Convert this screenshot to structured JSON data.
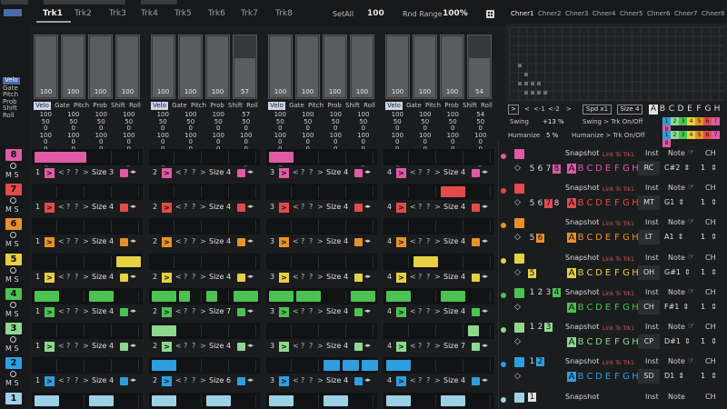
{
  "header": {
    "tabs": [
      "Trk1",
      "Trk2",
      "Trk3",
      "Trk4",
      "Trk5",
      "Trk6",
      "Trk7",
      "Trk8"
    ],
    "active_tab": "Trk1",
    "setall_label": "SetAll",
    "setall_value": "100",
    "rnd_range_label": "Rnd Range",
    "rnd_range_value": "100%"
  },
  "params": {
    "labels": [
      "Velo",
      "Gate",
      "Pitch",
      "Prob",
      "Shift",
      "Roll"
    ],
    "column_labels": [
      "Velo",
      "Gate",
      "Pitch",
      "Prob",
      "Shift",
      "Roll"
    ]
  },
  "groups": [
    {
      "faders": [
        "100",
        "100",
        "100",
        "100"
      ],
      "fader_levels": [
        0.0,
        0.0,
        0.0,
        0.0
      ],
      "rows": [
        [
          "100",
          "100",
          "100",
          "100"
        ],
        [
          "50",
          "50",
          "50",
          "50"
        ],
        [
          "0",
          "0",
          "0",
          "0"
        ],
        [
          "100",
          "100",
          "100",
          "100"
        ],
        [
          "0",
          "0",
          "0",
          "0"
        ],
        [
          "0",
          "0",
          "0",
          "0"
        ]
      ]
    },
    {
      "faders": [
        "100",
        "100",
        "100",
        "57"
      ],
      "fader_levels": [
        0.0,
        0.0,
        0.0,
        0.35
      ],
      "rows": [
        [
          "100",
          "100",
          "100",
          "57"
        ],
        [
          "50",
          "50",
          "50",
          "50"
        ],
        [
          "0",
          "0",
          "0",
          "0"
        ],
        [
          "100",
          "100",
          "100",
          "100"
        ],
        [
          "0",
          "0",
          "0",
          "0"
        ],
        [
          "0",
          "0",
          "0",
          "0"
        ]
      ]
    },
    {
      "faders": [
        "100",
        "100",
        "100",
        "100"
      ],
      "fader_levels": [
        0.0,
        0.0,
        0.0,
        0.0
      ],
      "rows": [
        [
          "100",
          "100",
          "100",
          "100"
        ],
        [
          "50",
          "50",
          "50",
          "50"
        ],
        [
          "0",
          "0",
          "0",
          "0"
        ],
        [
          "100",
          "100",
          "100",
          "100"
        ],
        [
          "0",
          "0",
          "0",
          "0"
        ],
        [
          "0",
          "0",
          "0",
          "0"
        ]
      ]
    },
    {
      "faders": [
        "100",
        "100",
        "100",
        "54"
      ],
      "fader_levels": [
        0.0,
        0.0,
        0.0,
        0.35
      ],
      "rows": [
        [
          "100",
          "100",
          "100",
          "54"
        ],
        [
          "50",
          "50",
          "50",
          "50"
        ],
        [
          "0",
          "0",
          "0",
          "0"
        ],
        [
          "100",
          "100",
          "100",
          "100"
        ],
        [
          "0",
          "0",
          "0",
          "0"
        ],
        [
          "0",
          "0",
          "0",
          "0"
        ]
      ]
    }
  ],
  "channels": {
    "tabs": [
      "Chner1",
      "Chner2",
      "Chner3",
      "Chner4",
      "Chner5",
      "Chner6",
      "Chner7",
      "Chner8"
    ],
    "active": "Chner1",
    "spd_label": "Spd x1",
    "size_label": "Size 4",
    "shift_left": "<-1",
    "shift_right": "<-2",
    "letters": [
      "A",
      "B",
      "C",
      "D",
      "E",
      "F",
      "G",
      "H"
    ],
    "swing_label": "Swing",
    "swing_value": "+13 %",
    "swing_trk": "Swing > Trk On/Off",
    "humanize_label": "Humanize",
    "humanize_value": "5 %",
    "humanize_trk": "Humanize > Trk On/Off",
    "badge_nums": [
      "1",
      "2",
      "3",
      "4",
      "5",
      "6",
      "7",
      "8"
    ]
  },
  "columns": {
    "snapshot": "Snapshot",
    "inst": "Inst",
    "note": "Note",
    "ch": "CH",
    "link": "Link To Trk1"
  },
  "tracks": [
    {
      "num": "8",
      "color": "#e05aa5",
      "size": [
        "Size 3",
        "Size 4",
        "Size 4",
        "Size 4"
      ],
      "inst": "RC",
      "note": "C#2",
      "ch": "1",
      "row_nums": [
        "5",
        "6",
        "7",
        "8"
      ],
      "hl": "8"
    },
    {
      "num": "7",
      "color": "#e24b4b",
      "size": [
        "Size 4",
        "Size 4",
        "Size 4",
        "Size 4"
      ],
      "inst": "MT",
      "note": "G1",
      "ch": "1",
      "row_nums": [
        "5",
        "6",
        "7",
        "8"
      ],
      "hl": "7"
    },
    {
      "num": "6",
      "color": "#e8912a",
      "size": [
        "Size 4",
        "Size 4",
        "Size 4",
        "Size 4"
      ],
      "inst": "LT",
      "note": "A1",
      "ch": "1",
      "row_nums": [
        "5",
        "6"
      ],
      "hl": "6"
    },
    {
      "num": "5",
      "color": "#e6d043",
      "size": [
        "Size 4",
        "Size 4",
        "Size 4",
        "Size 4"
      ],
      "inst": "OH",
      "note": "G#1",
      "ch": "1",
      "row_nums": [
        "5"
      ],
      "hl": "5"
    },
    {
      "num": "4",
      "color": "#4cc253",
      "size": [
        "Size 4",
        "Size 7",
        "Size 4",
        "Size 4"
      ],
      "inst": "CH",
      "note": "F#1",
      "ch": "1",
      "row_nums": [
        "1",
        "2",
        "3",
        "4"
      ],
      "hl": "4"
    },
    {
      "num": "3",
      "color": "#8ed890",
      "size": [
        "Size 4",
        "Size 4",
        "Size 4",
        "Size 7"
      ],
      "inst": "CP",
      "note": "D#1",
      "ch": "1",
      "row_nums": [
        "1",
        "2",
        "3"
      ],
      "hl": "3"
    },
    {
      "num": "2",
      "color": "#2e9ee0",
      "size": [
        "Size 4",
        "Size 6",
        "Size 4",
        "Size 4"
      ],
      "inst": "SD",
      "note": "D1",
      "ch": "1",
      "row_nums": [
        "1",
        "2"
      ],
      "hl": "2"
    },
    {
      "num": "1",
      "color": "#9fd1e6",
      "size": [
        "",
        "",
        "",
        ""
      ],
      "inst": "",
      "note": "",
      "ch": "",
      "row_nums": [
        "1"
      ],
      "hl": "1"
    }
  ]
}
